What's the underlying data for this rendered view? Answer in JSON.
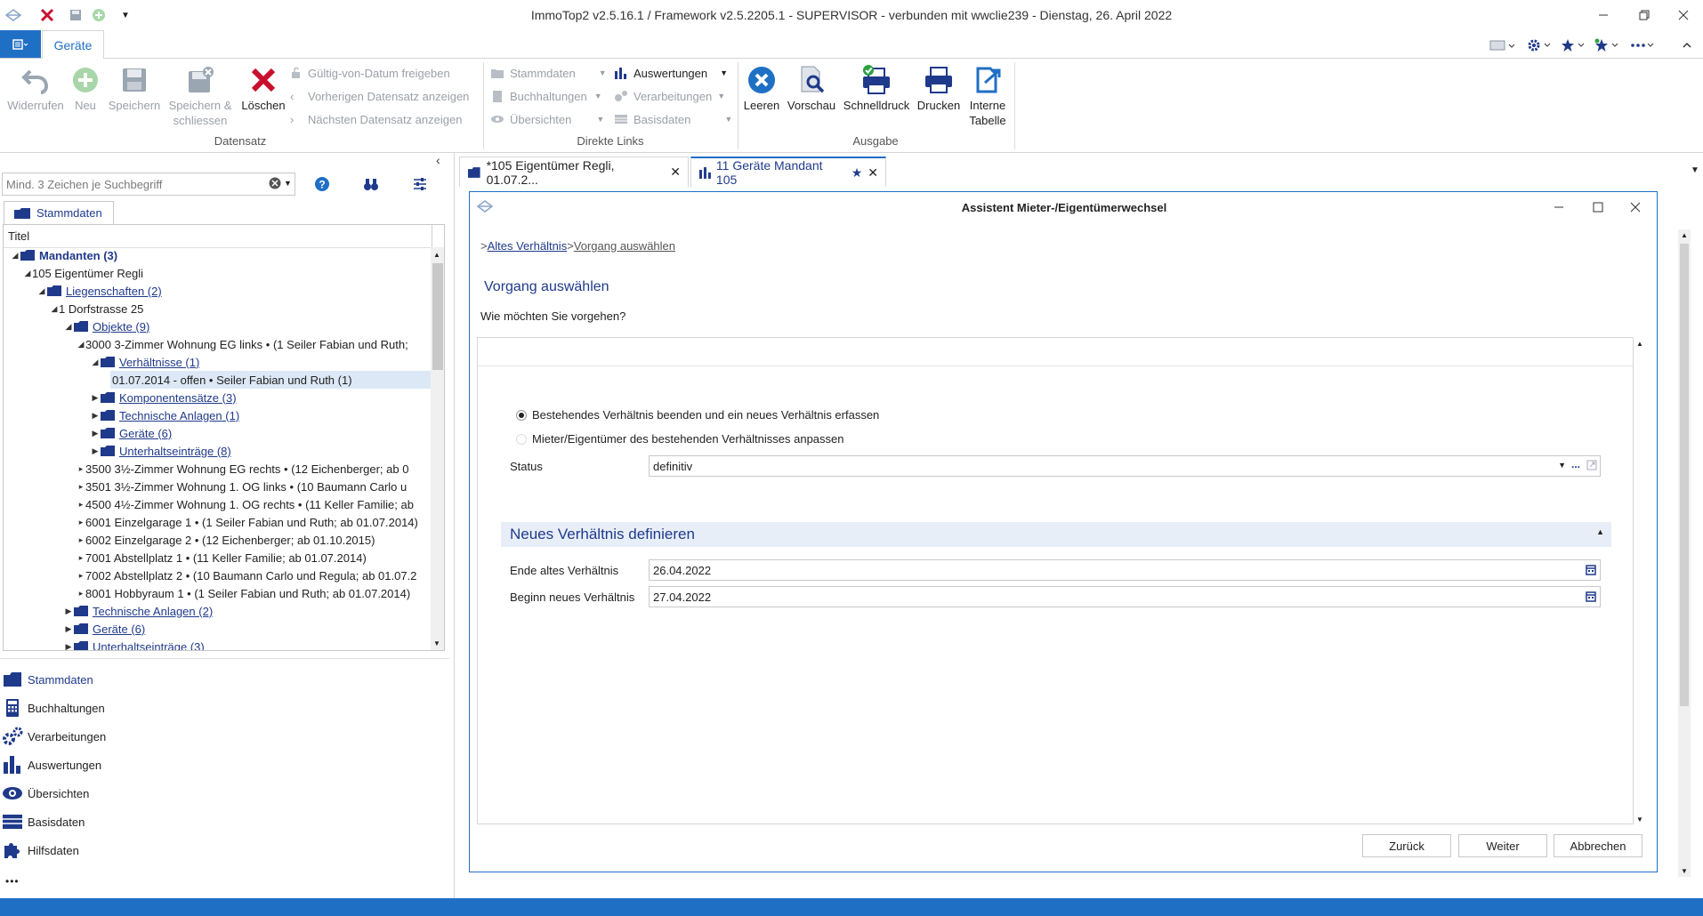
{
  "window": {
    "title": "ImmoTop2 v2.5.16.1 / Framework v2.5.2205.1 - SUPERVISOR - verbunden mit wwclie239 - Dienstag, 26. April 2022"
  },
  "ribbon": {
    "tab": "Geräte",
    "datensatz": {
      "label": "Datensatz",
      "widerrufen": "Widerrufen",
      "neu": "Neu",
      "speichern": "Speichern",
      "speichern_schliessen_1": "Speichern &",
      "speichern_schliessen_2": "schliessen",
      "loeschen": "Löschen",
      "gueltig": "Gültig-von-Datum freigeben",
      "vorheriger": "Vorherigen Datensatz anzeigen",
      "naechster": "Nächsten Datensatz anzeigen"
    },
    "direkte_links": {
      "label": "Direkte Links",
      "stammdaten": "Stammdaten",
      "buchhaltungen": "Buchhaltungen",
      "uebersichten": "Übersichten",
      "auswertungen": "Auswertungen",
      "verarbeitungen": "Verarbeitungen",
      "basisdaten": "Basisdaten"
    },
    "ausgabe": {
      "label": "Ausgabe",
      "leeren": "Leeren",
      "vorschau": "Vorschau",
      "schnelldruck": "Schnelldruck",
      "drucken": "Drucken",
      "interne_1": "Interne",
      "interne_2": "Tabelle"
    }
  },
  "left": {
    "search_placeholder": "Mind. 3 Zeichen je Suchbegriff",
    "tab": "Stammdaten",
    "tree_header": "Titel",
    "tree": [
      {
        "text": "Mandanten  (3)"
      },
      {
        "text": "105 Eigentümer Regli"
      },
      {
        "text": "Liegenschaften  (2)"
      },
      {
        "text": "1 Dorfstrasse 25"
      },
      {
        "text": "Objekte  (9)"
      },
      {
        "text": "3000 3-Zimmer Wohnung EG links • (1 Seiler Fabian und Ruth;"
      },
      {
        "text": "Verhältnisse  (1)"
      },
      {
        "text": "01.07.2014 - offen • Seiler Fabian und Ruth (1)"
      },
      {
        "text": "Komponentensätze  (3)"
      },
      {
        "text": "Technische Anlagen  (1)"
      },
      {
        "text": "Geräte  (6)"
      },
      {
        "text": "Unterhaltseinträge  (8)"
      },
      {
        "text": "3500 3½-Zimmer Wohnung EG rechts • (12 Eichenberger; ab 0"
      },
      {
        "text": "3501 3½-Zimmer Wohnung 1. OG links • (10 Baumann Carlo u"
      },
      {
        "text": "4500 4½-Zimmer Wohnung 1. OG rechts • (11 Keller Familie; ab"
      },
      {
        "text": "6001 Einzelgarage 1 • (1 Seiler Fabian und Ruth; ab 01.07.2014)"
      },
      {
        "text": "6002 Einzelgarage 2 • (12 Eichenberger; ab 01.10.2015)"
      },
      {
        "text": "7001 Abstellplatz 1 • (11 Keller Familie; ab 01.07.2014)"
      },
      {
        "text": "7002 Abstellplatz 2 • (10 Baumann Carlo und Regula; ab 01.07.2"
      },
      {
        "text": "8001 Hobbyraum 1 • (1 Seiler Fabian und Ruth; ab 01.07.2014)"
      },
      {
        "text": "Technische Anlagen  (2)"
      },
      {
        "text": "Geräte  (6)"
      },
      {
        "text": "Unterhaltseinträge  (3)"
      }
    ],
    "nav": [
      "Stammdaten",
      "Buchhaltungen",
      "Verarbeitungen",
      "Auswertungen",
      "Übersichten",
      "Basisdaten",
      "Hilfsdaten"
    ],
    "more": "•••"
  },
  "doctabs": [
    {
      "label": "*105 Eigentümer Regli, 01.07.2..."
    },
    {
      "label": "11 Geräte Mandant 105"
    }
  ],
  "dialog": {
    "title": "Assistent Mieter-/Eigentümerwechsel",
    "breadcrumb_prefix": ">",
    "breadcrumb_1": "Altes Verhältnis",
    "breadcrumb_sep": ">",
    "breadcrumb_2": "Vorgang auswählen",
    "heading": "Vorgang auswählen",
    "question": "Wie möchten Sie vorgehen?",
    "option_1": "Bestehendes Verhältnis beenden und ein neues Verhältnis erfassen",
    "option_2": "Mieter/Eigentümer des bestehenden Verhältnisses anpassen",
    "status_label": "Status",
    "status_value": "definitiv",
    "section_title": "Neues Verhältnis definieren",
    "ende_label": "Ende altes Verhältnis",
    "ende_value": "26.04.2022",
    "beginn_label": "Beginn neues Verhältnis",
    "beginn_value": "27.04.2022",
    "btn_zurueck": "Zurück",
    "btn_weiter": "Weiter",
    "btn_abbrechen": "Abbrechen"
  },
  "colors": {
    "accent": "#1f6fc5",
    "navy": "#1f3a8a",
    "delete_red": "#c8102e",
    "section_bg": "#e8eef8"
  }
}
